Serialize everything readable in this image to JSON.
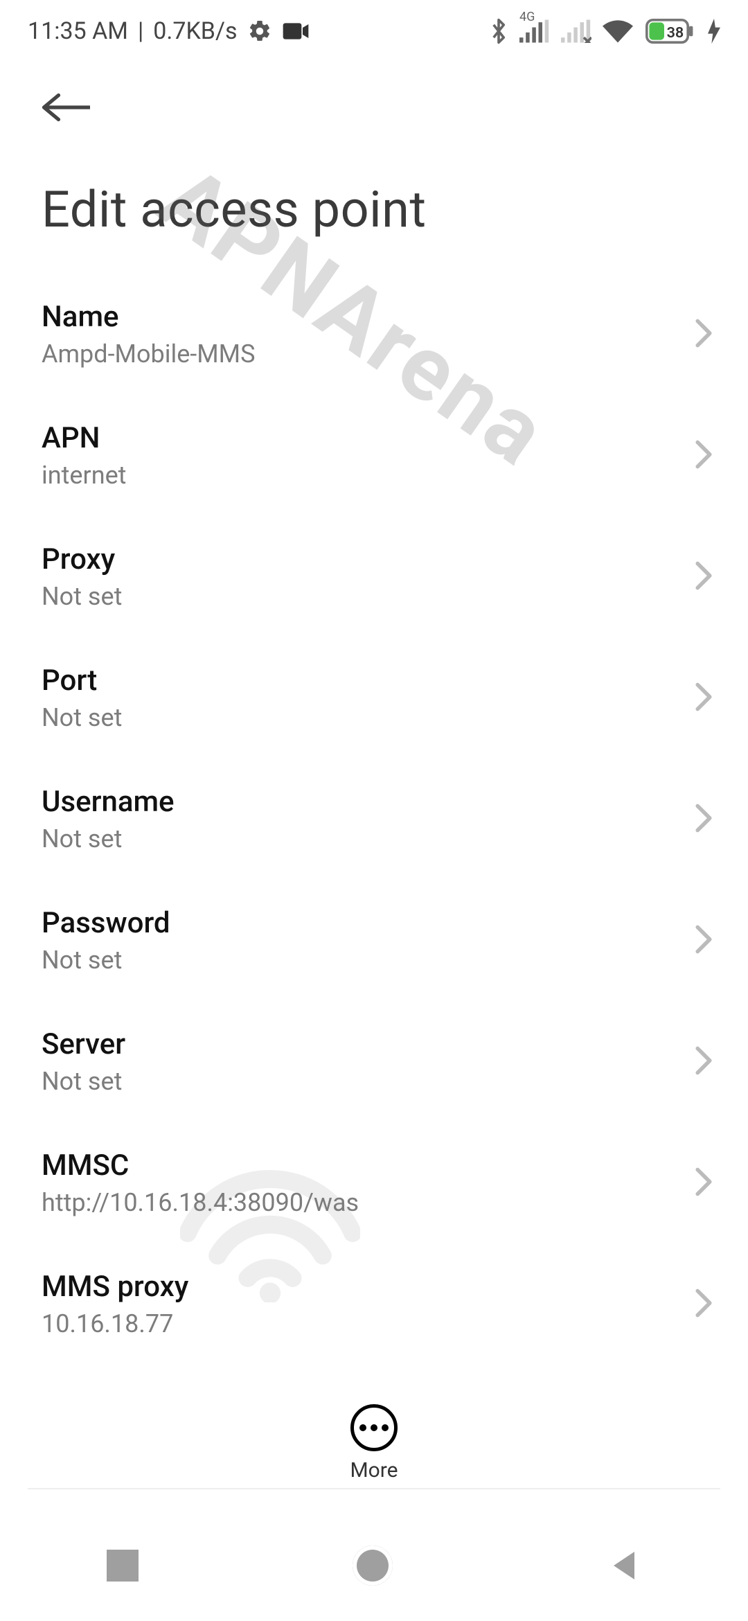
{
  "statusbar": {
    "time": "11:35 AM",
    "sep": "|",
    "speed": "0.7KB/s",
    "netlabel": "4G",
    "battery": "38"
  },
  "page": {
    "title": "Edit access point"
  },
  "items": [
    {
      "label": "Name",
      "value": "Ampd-Mobile-MMS"
    },
    {
      "label": "APN",
      "value": "internet"
    },
    {
      "label": "Proxy",
      "value": "Not set"
    },
    {
      "label": "Port",
      "value": "Not set"
    },
    {
      "label": "Username",
      "value": "Not set"
    },
    {
      "label": "Password",
      "value": "Not set"
    },
    {
      "label": "Server",
      "value": "Not set"
    },
    {
      "label": "MMSC",
      "value": "http://10.16.18.4:38090/was"
    },
    {
      "label": "MMS proxy",
      "value": "10.16.18.77"
    }
  ],
  "more": {
    "label": "More"
  },
  "watermark_text": "APNArena"
}
